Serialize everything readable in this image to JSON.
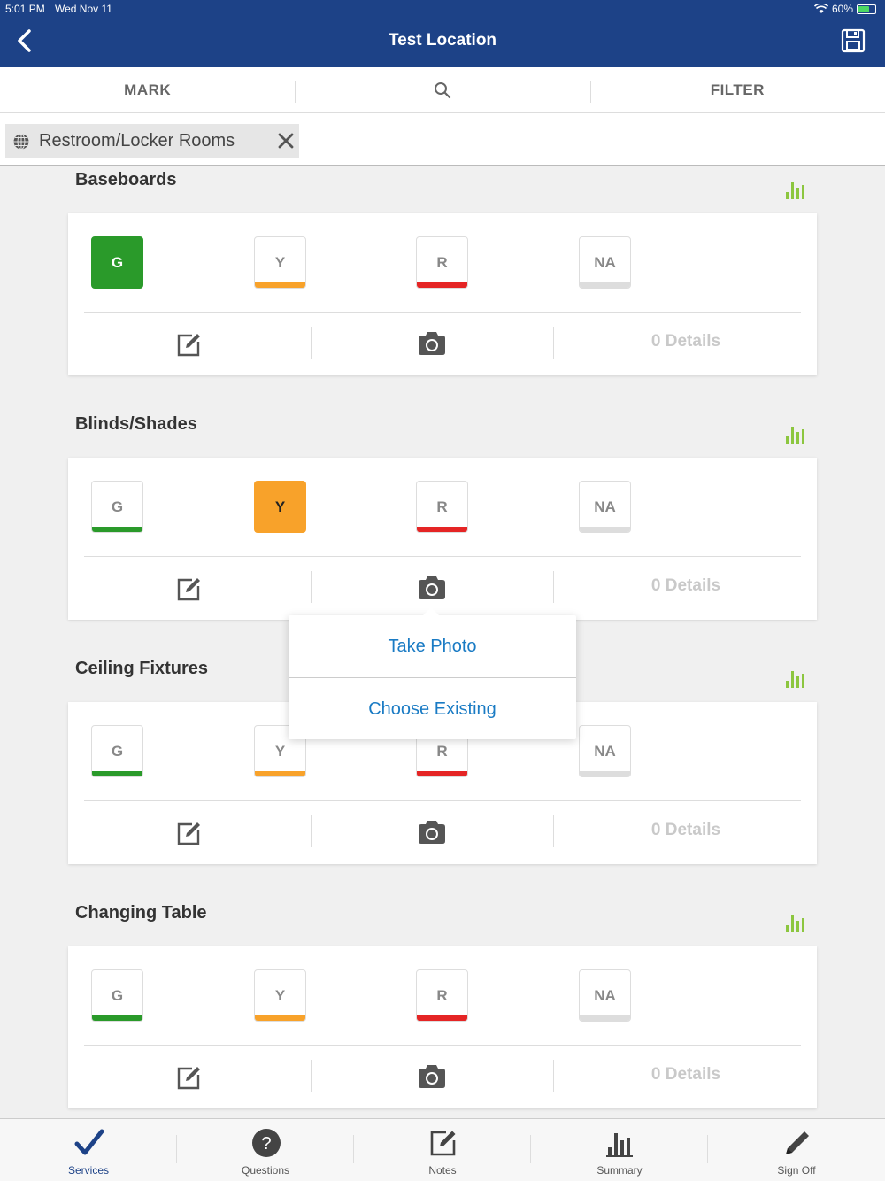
{
  "status": {
    "time": "5:01 PM",
    "date": "Wed Nov 11",
    "battery": "60%",
    "battery_level": 0.6
  },
  "header": {
    "title": "Test Location",
    "back_icon": "chevron-left-icon",
    "save_icon": "floppy-disk-icon"
  },
  "toolbar": {
    "mark_label": "MARK",
    "search_icon": "search-icon",
    "filter_label": "FILTER"
  },
  "filter": {
    "chip_label": "Restroom/Locker Rooms",
    "chip_icon": "globe-icon",
    "close_icon": "close-icon"
  },
  "colors": {
    "header": "#1d4287",
    "green": "#2a9a2a",
    "yellow": "#f8a22a",
    "red": "#e52525",
    "na": "#dddddd",
    "link": "#1a7bc4",
    "chart": "#8cc63f"
  },
  "sections": [
    {
      "title": "Baseboards",
      "ratings": [
        "G",
        "Y",
        "R",
        "NA"
      ],
      "selected": "G",
      "details": "0 Details"
    },
    {
      "title": "Blinds/Shades",
      "ratings": [
        "G",
        "Y",
        "R",
        "NA"
      ],
      "selected": "Y",
      "details": "0 Details"
    },
    {
      "title": "Ceiling Fixtures",
      "ratings": [
        "G",
        "Y",
        "R",
        "NA"
      ],
      "selected": "",
      "details": "0 Details"
    },
    {
      "title": "Changing Table",
      "ratings": [
        "G",
        "Y",
        "R",
        "NA"
      ],
      "selected": "",
      "details": "0 Details"
    }
  ],
  "popover": {
    "take_photo": "Take Photo",
    "choose_existing": "Choose Existing"
  },
  "tabs": [
    {
      "label": "Services",
      "icon": "checkmark-icon",
      "active": true
    },
    {
      "label": "Questions",
      "icon": "question-icon",
      "active": false
    },
    {
      "label": "Notes",
      "icon": "notes-icon",
      "active": false
    },
    {
      "label": "Summary",
      "icon": "bar-chart-icon",
      "active": false
    },
    {
      "label": "Sign Off",
      "icon": "pencil-icon",
      "active": false
    }
  ]
}
